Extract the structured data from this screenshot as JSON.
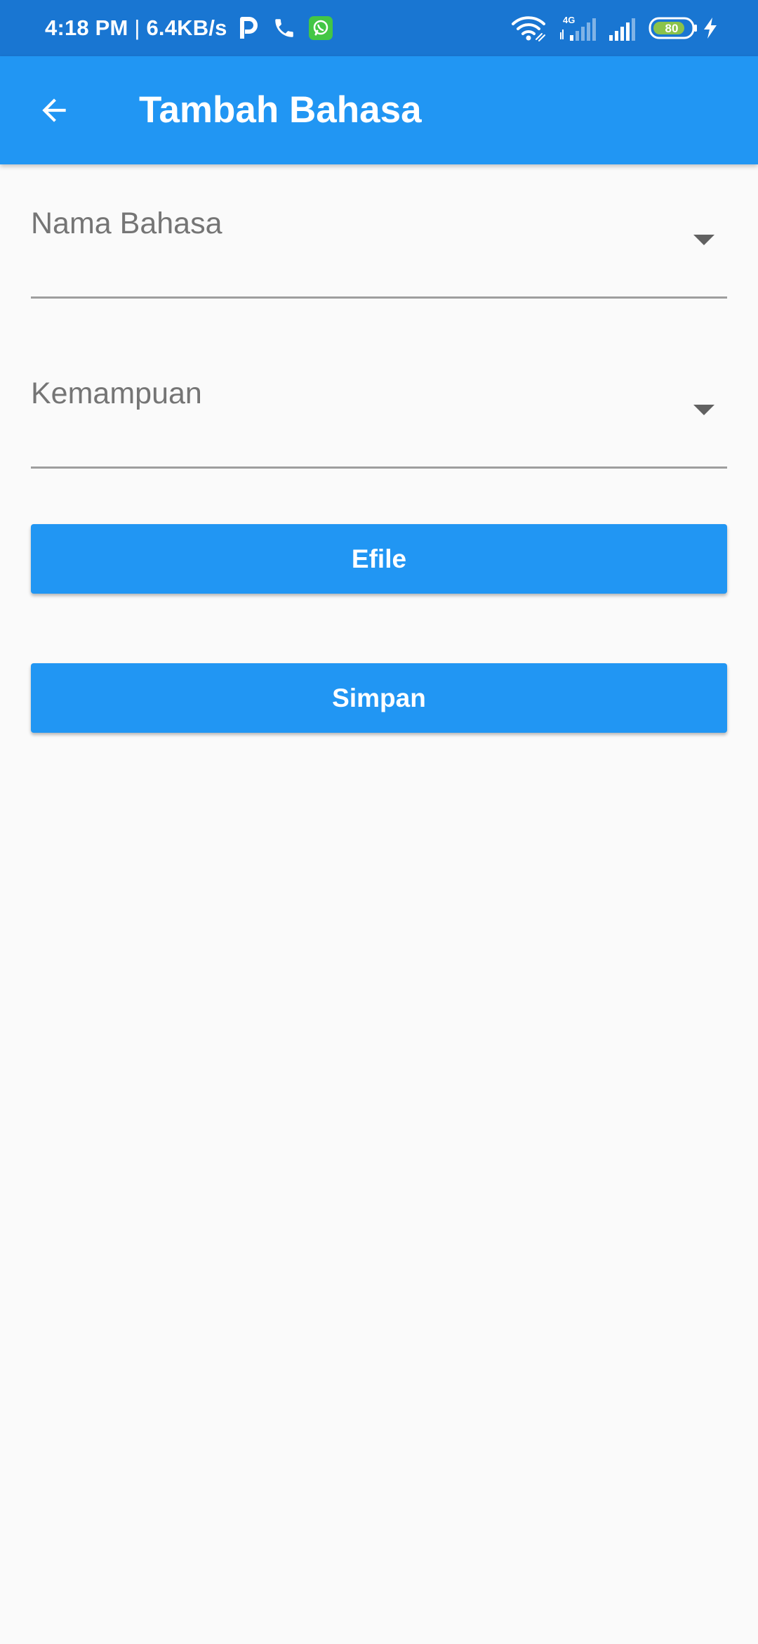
{
  "status_bar": {
    "time": "4:18 PM",
    "separator": "|",
    "speed": "6.4KB/s",
    "network_label": "4G",
    "battery": "80",
    "icons": [
      "parking-icon",
      "phone-icon",
      "whatsapp-icon",
      "wifi-icon",
      "signal-4g-icon",
      "signal-icon",
      "battery-icon",
      "charging-icon"
    ],
    "background_color": "#1976d2"
  },
  "app_bar": {
    "title": "Tambah Bahasa",
    "back_icon": "arrow-back-icon",
    "background_color": "#2196f3"
  },
  "form": {
    "language_field": {
      "label": "Nama Bahasa",
      "icon": "dropdown-arrow-icon"
    },
    "ability_field": {
      "label": "Kemampuan",
      "icon": "dropdown-arrow-icon"
    },
    "efile_button": {
      "label": "Efile"
    },
    "save_button": {
      "label": "Simpan"
    }
  },
  "colors": {
    "accent": "#2196f3",
    "background": "#fafafa",
    "label_gray": "#757575",
    "underline": "#9e9e9e"
  }
}
